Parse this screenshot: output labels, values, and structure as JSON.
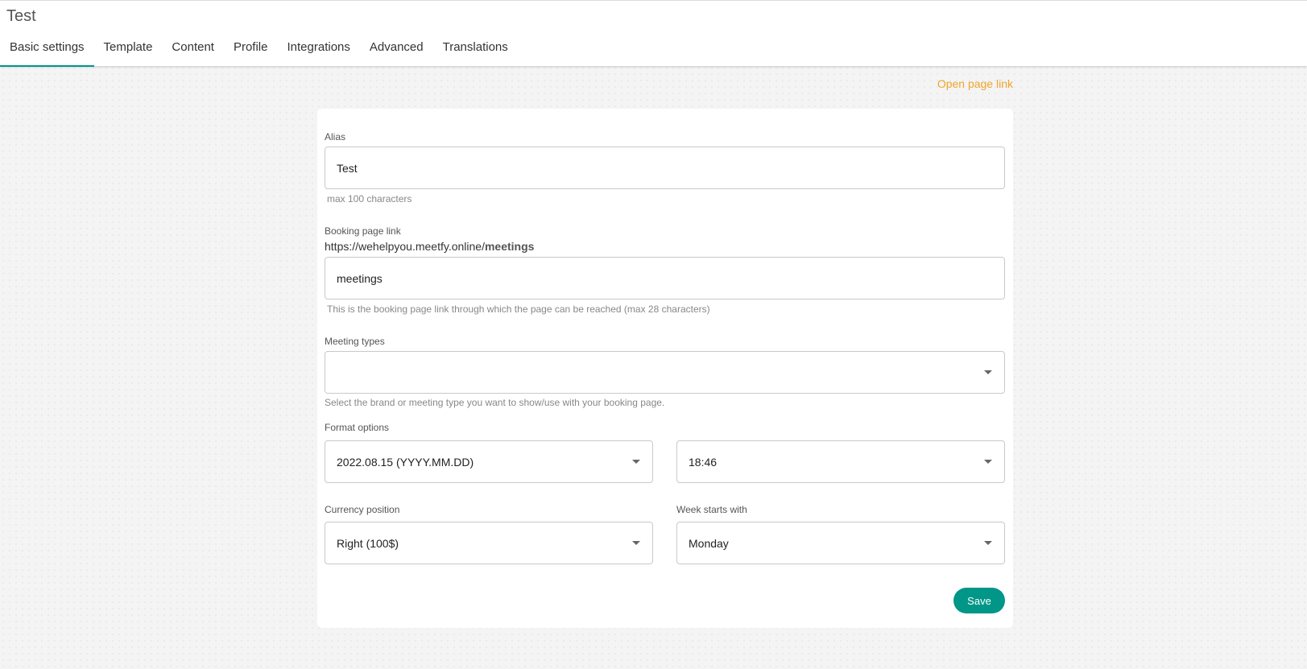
{
  "page": {
    "title": "Test"
  },
  "tabs": [
    {
      "label": "Basic settings"
    },
    {
      "label": "Template"
    },
    {
      "label": "Content"
    },
    {
      "label": "Profile"
    },
    {
      "label": "Integrations"
    },
    {
      "label": "Advanced"
    },
    {
      "label": "Translations"
    }
  ],
  "open_page_link": "Open page link",
  "alias": {
    "label": "Alias",
    "value": "Test",
    "hint": "max 100 characters"
  },
  "booking_link": {
    "label": "Booking page link",
    "base_url": "https://wehelpyou.meetfy.online/",
    "slug_bold": "meetings",
    "value": "meetings",
    "hint": "This is the booking page link through which the page can be reached (max 28 characters)"
  },
  "meeting_types": {
    "label": "Meeting types",
    "value": "",
    "hint": "Select the brand or meeting type you want to show/use with your booking page."
  },
  "format_options": {
    "label": "Format options",
    "date_format": "2022.08.15 (YYYY.MM.DD)",
    "time_format": "18:46"
  },
  "currency_position": {
    "label": "Currency position",
    "value": "Right (100$)"
  },
  "week_start": {
    "label": "Week starts with",
    "value": "Monday"
  },
  "save_label": "Save",
  "colors": {
    "accent": "#009688",
    "link": "#f0a52b"
  }
}
